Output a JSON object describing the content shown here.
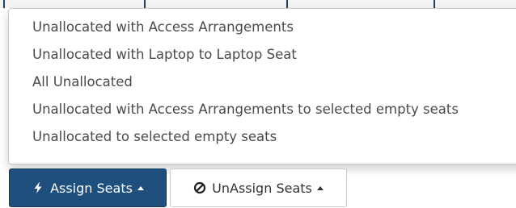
{
  "dropdown": {
    "items": [
      {
        "label": "Unallocated with Access Arrangements"
      },
      {
        "label": "Unallocated with Laptop to Laptop Seat"
      },
      {
        "label": "All Unallocated"
      },
      {
        "label": "Unallocated with Access Arrangements to selected empty seats"
      },
      {
        "label": "Unallocated to selected empty seats"
      }
    ]
  },
  "toolbar": {
    "assign_label": "Assign Seats",
    "assign_icon": "bolt-icon",
    "unassign_label": "UnAssign Seats",
    "unassign_icon": "ban-icon"
  },
  "colors": {
    "primary": "#1f4f7c",
    "menu_text": "#4a4a4a"
  }
}
